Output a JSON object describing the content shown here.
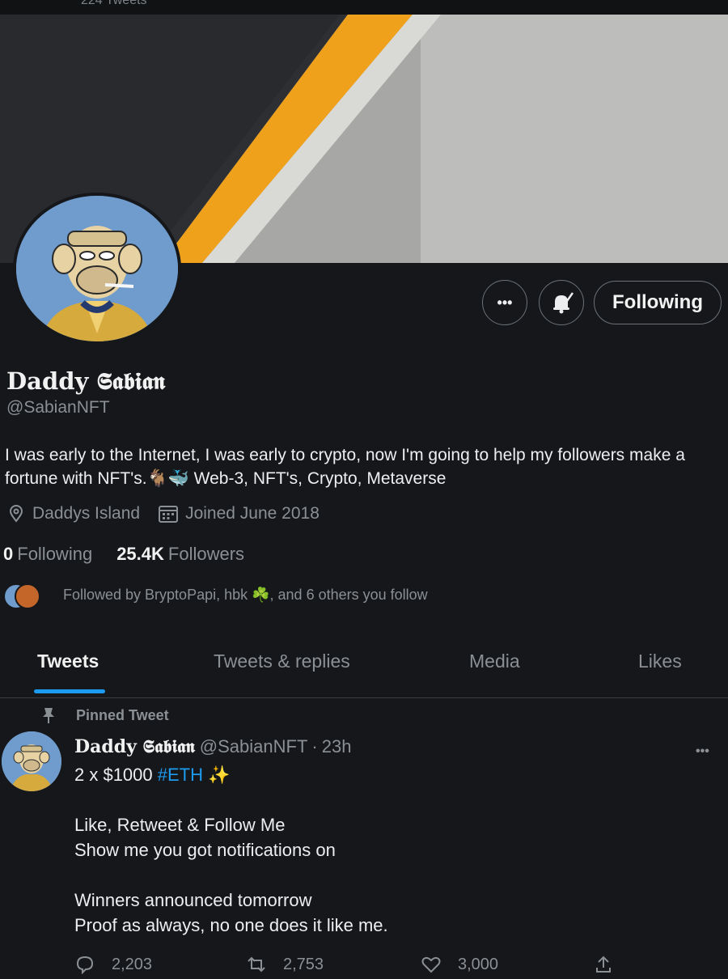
{
  "top_strip": {
    "text": "224 Tweets"
  },
  "profile": {
    "display_name": "Daddy 𝕾𝖆𝖇𝖎𝖆𝖓",
    "handle": "@SabianNFT",
    "bio": "I was early to the Internet, I was early to crypto, now I'm going to help my followers make a fortune with NFT's.🐐🐳 Web-3, NFT's, Crypto, Metaverse",
    "location": "Daddys Island",
    "joined": "Joined June 2018",
    "following_count": "0",
    "following_label": "Following",
    "followers_count": "25.4K",
    "followers_label": "Followers",
    "followed_by": "Followed by BryptoPapi, hbk ☘️, and 6 others you follow"
  },
  "actions": {
    "more_label": "•••",
    "following_button": "Following"
  },
  "tabs": [
    {
      "label": "Tweets",
      "active": true
    },
    {
      "label": "Tweets & replies",
      "active": false
    },
    {
      "label": "Media",
      "active": false
    },
    {
      "label": "Likes",
      "active": false
    }
  ],
  "pinned_tweet": {
    "pinned_label": "Pinned Tweet",
    "author_name": "Daddy 𝕾𝖆𝖇𝖎𝖆𝖓",
    "author_handle": "@SabianNFT",
    "separator": "·",
    "time": "23h",
    "more_label": "•••",
    "first_line_prefix": "2 x $1000 ",
    "hashtag": "#ETH",
    "sparkle": " ✨",
    "lines": [
      "",
      "Like, Retweet & Follow Me",
      "Show me you got notifications on",
      "",
      "Winners announced tomorrow",
      "Proof as always, no one does it like me."
    ],
    "reply_count": "2,203",
    "retweet_count": "2,753",
    "like_count": "3,000"
  },
  "colors": {
    "background": "#15171a",
    "accent": "#1d9bf0",
    "muted_text": "#8b9095",
    "banner_orange": "#f0a11c"
  },
  "icons": {
    "location": "location-pin-icon",
    "calendar": "calendar-icon",
    "bell": "bell-check-icon",
    "pin": "pin-icon",
    "reply": "reply-icon",
    "retweet": "retweet-icon",
    "like": "heart-icon",
    "share": "share-icon"
  }
}
